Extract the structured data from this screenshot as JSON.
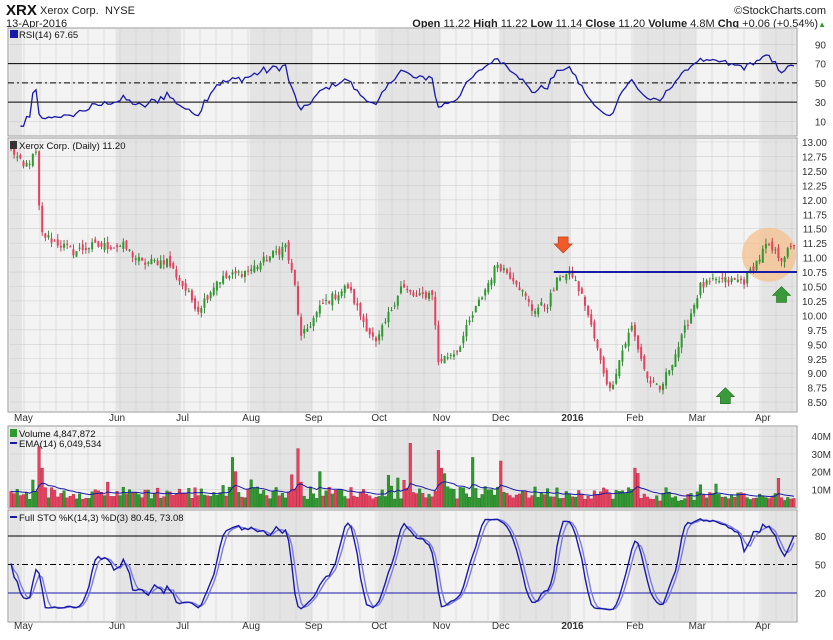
{
  "header": {
    "symbol": "XRX",
    "name": "Xerox Corp.",
    "exchange": "NYSE",
    "date": "13-Apr-2016",
    "brand": "©StockCharts.com",
    "open_label": "Open",
    "open": "11.22",
    "high_label": "High",
    "high": "11.22",
    "low_label": "Low",
    "low": "11.14",
    "close_label": "Close",
    "close": "11.20",
    "volume_label": "Volume",
    "volume": "4.8M",
    "chg_label": "Chg",
    "chg": "+0.06 (+0.54%)",
    "chg_arrow": "▲"
  },
  "legends": {
    "rsi": "RSI(14) 67.65",
    "price": "Xerox Corp. (Daily) 11.20",
    "volume": "Volume 4,847,872",
    "ema": "EMA(14) 6,049,534",
    "sto": "Full STO %K(14,3) %D(3) 80.45, 73.08"
  },
  "colors": {
    "up": "#2e9a2e",
    "down": "#e8405e",
    "line": "#1a1aa8",
    "line_light": "#7b7be0",
    "highlight": "#f5c08e",
    "arrow_down": "#f25a2a",
    "arrow_up": "#3a9a3a"
  },
  "chart_data": {
    "type": "candlestick",
    "title": "XRX Xerox Corp. NYSE (Daily)",
    "total_days": 252,
    "months": [
      {
        "label": "May",
        "day": 4
      },
      {
        "label": "Jun",
        "day": 34
      },
      {
        "label": "Jul",
        "day": 55
      },
      {
        "label": "Aug",
        "day": 77
      },
      {
        "label": "Sep",
        "day": 97
      },
      {
        "label": "Oct",
        "day": 118
      },
      {
        "label": "Nov",
        "day": 138
      },
      {
        "label": "Dec",
        "day": 157
      },
      {
        "label": "2016",
        "day": 180
      },
      {
        "label": "Feb",
        "day": 200
      },
      {
        "label": "Mar",
        "day": 220
      },
      {
        "label": "Apr",
        "day": 241
      }
    ],
    "price_ticks": [
      "13.00",
      "12.75",
      "12.50",
      "12.25",
      "12.00",
      "11.75",
      "11.50",
      "11.25",
      "11.00",
      "10.75",
      "10.50",
      "10.25",
      "10.00",
      "9.75",
      "9.50",
      "9.25",
      "9.00",
      "8.75",
      "8.50"
    ],
    "price_range": [
      8.4,
      13.07
    ],
    "close_keypoints": [
      [
        0,
        12.9
      ],
      [
        4,
        12.55
      ],
      [
        8,
        12.8
      ],
      [
        9,
        11.85
      ],
      [
        10,
        11.4
      ],
      [
        20,
        11.1
      ],
      [
        26,
        11.2
      ],
      [
        36,
        11.2
      ],
      [
        42,
        10.9
      ],
      [
        50,
        10.95
      ],
      [
        60,
        10.1
      ],
      [
        66,
        10.6
      ],
      [
        77,
        10.8
      ],
      [
        88,
        11.2
      ],
      [
        91,
        10.5
      ],
      [
        93,
        9.6
      ],
      [
        100,
        10.2
      ],
      [
        108,
        10.5
      ],
      [
        112,
        10.0
      ],
      [
        117,
        9.5
      ],
      [
        125,
        10.5
      ],
      [
        130,
        10.3
      ],
      [
        135,
        10.4
      ],
      [
        137,
        9.2
      ],
      [
        143,
        9.4
      ],
      [
        148,
        10.0
      ],
      [
        156,
        10.9
      ],
      [
        162,
        10.6
      ],
      [
        167,
        10.1
      ],
      [
        172,
        10.2
      ],
      [
        176,
        10.7
      ],
      [
        180,
        10.7
      ],
      [
        184,
        10.2
      ],
      [
        189,
        9.2
      ],
      [
        192,
        8.7
      ],
      [
        196,
        9.4
      ],
      [
        199,
        9.8
      ],
      [
        204,
        8.9
      ],
      [
        208,
        8.7
      ],
      [
        215,
        9.6
      ],
      [
        221,
        10.5
      ],
      [
        227,
        10.6
      ],
      [
        235,
        10.6
      ],
      [
        240,
        11.0
      ],
      [
        242,
        11.2
      ],
      [
        247,
        11.0
      ],
      [
        251,
        11.2
      ]
    ],
    "rsi": {
      "ticks": [
        90,
        70,
        50,
        30,
        10
      ],
      "overbought": 70,
      "oversold": 30,
      "last": 67.65
    },
    "volume": {
      "ticks": [
        "40M",
        "30M",
        "20M",
        "10M"
      ],
      "max_millions": 45,
      "baseline_millions": 8,
      "spikes": [
        [
          9,
          34
        ],
        [
          10,
          22
        ],
        [
          71,
          28
        ],
        [
          72,
          20
        ],
        [
          92,
          33
        ],
        [
          99,
          20
        ],
        [
          128,
          36
        ],
        [
          137,
          32
        ],
        [
          138,
          22
        ],
        [
          148,
          28
        ],
        [
          157,
          26
        ],
        [
          200,
          22
        ],
        [
          201,
          19
        ],
        [
          226,
          13
        ]
      ],
      "last_millions": 4.85,
      "ema_last_millions": 6.05
    },
    "stochastic": {
      "ticks": [
        80,
        50,
        20
      ],
      "k": 80.45,
      "d": 73.08
    },
    "annotations": {
      "resistance_price": 10.75,
      "resistance_from_day": 174,
      "down_arrow": {
        "day": 177,
        "price": 11.08
      },
      "up_arrows": [
        {
          "day": 229,
          "price": 8.75
        },
        {
          "day": 247,
          "price": 10.5
        }
      ],
      "highlight": {
        "day": 243,
        "price": 11.05
      }
    }
  }
}
